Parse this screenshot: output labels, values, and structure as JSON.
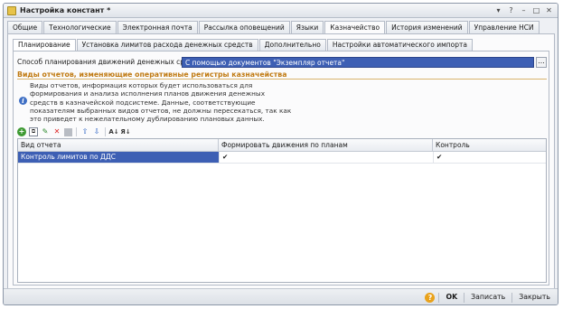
{
  "window": {
    "title": "Настройка констант *",
    "buttons": {
      "menu": "▾",
      "help": "?",
      "minimize": "–",
      "maximize": "□",
      "close": "✕"
    }
  },
  "main_tabs": [
    {
      "label": "Общие",
      "active": false
    },
    {
      "label": "Технологические",
      "active": false
    },
    {
      "label": "Электронная почта",
      "active": false
    },
    {
      "label": "Рассылка оповещений",
      "active": false
    },
    {
      "label": "Языки",
      "active": false
    },
    {
      "label": "Казначейство",
      "active": true
    },
    {
      "label": "История изменений",
      "active": false
    },
    {
      "label": "Управление НСИ",
      "active": false
    }
  ],
  "sub_tabs": [
    {
      "label": "Планирование",
      "active": true
    },
    {
      "label": "Установка лимитов расхода денежных средств",
      "active": false
    },
    {
      "label": "Дополнительно",
      "active": false
    },
    {
      "label": "Настройки автоматического импорта",
      "active": false
    }
  ],
  "planning": {
    "method_label": "Способ планирования движений денежных средств:",
    "method_value": "С помощью документов \"Экземпляр отчета\"",
    "method_button": "..."
  },
  "group": {
    "title": "Виды отчетов, изменяющие оперативные регистры казначейства",
    "info_icon": "i",
    "info_text": "Виды отчетов, информация которых будет использоваться для формирования и анализа исполнения планов движения денежных средств в казначейской подсистеме. Данные, соответствующие показателям выбранных видов отчетов, не должны пересекаться, так как это приведет к нежелательному дублированию плановых данных."
  },
  "toolbar": {
    "icons": [
      "add-icon",
      "copy-icon",
      "edit-icon",
      "delete-icon",
      "disabled-icon",
      "move-up-icon",
      "move-down-icon",
      "sort-asc-icon",
      "sort-desc-icon"
    ],
    "glyphs": {
      "add": "+",
      "copy": "⧉",
      "edit": "✎",
      "delete": "✕",
      "up": "⇧",
      "down": "⇩",
      "sort_asc": "A↓",
      "sort_desc": "Я↓"
    }
  },
  "table": {
    "columns": [
      "Вид отчета",
      "Формировать движения по планам",
      "Контроль"
    ],
    "rows": [
      {
        "report_type": "Контроль лимитов по ДДС",
        "form_by_plans": "✔",
        "control": "✔"
      }
    ]
  },
  "footer": {
    "help": "?",
    "ok": "OK",
    "save": "Записать",
    "close": "Закрыть"
  },
  "colors": {
    "selection": "#3d5fb4",
    "group_title": "#c07a12",
    "info_icon": "#3f6fc4"
  }
}
